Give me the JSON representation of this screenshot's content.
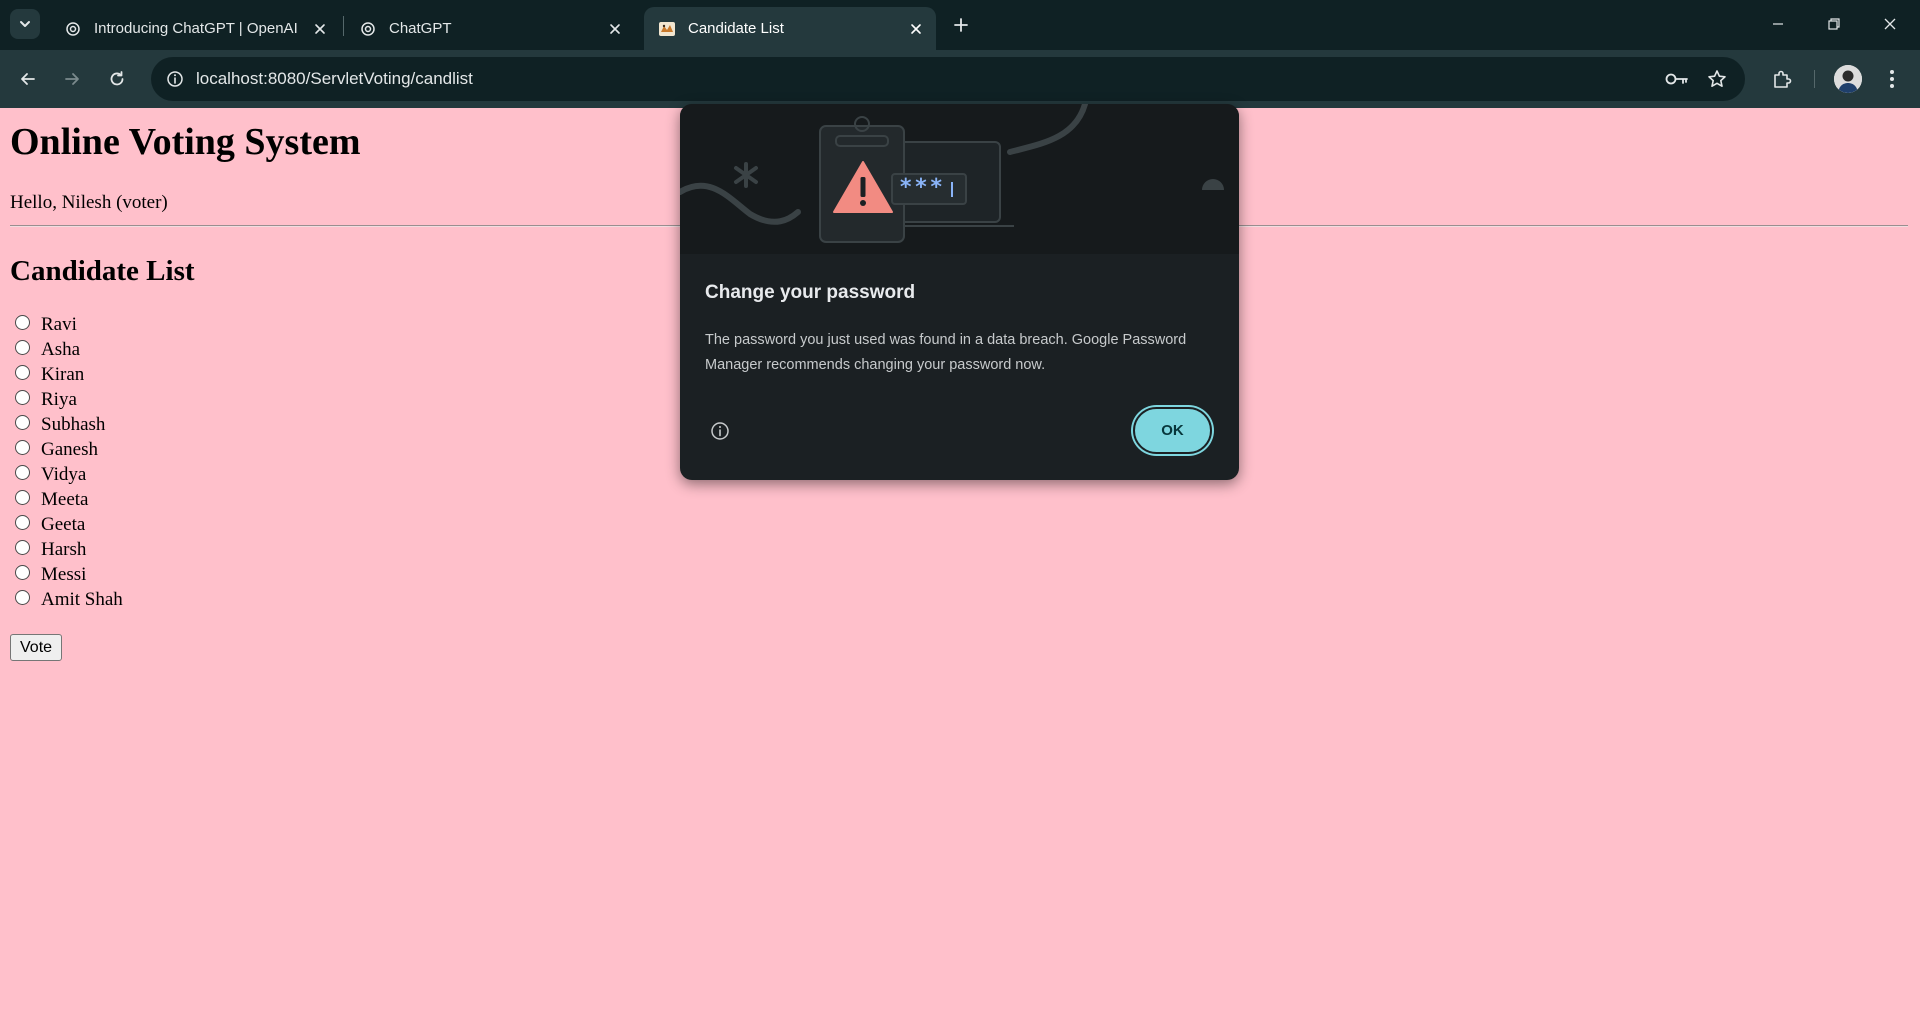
{
  "browser": {
    "tabs": [
      {
        "title": "Introducing ChatGPT | OpenAI",
        "favicon": "openai-icon",
        "active": false
      },
      {
        "title": "ChatGPT",
        "favicon": "openai-icon",
        "active": false
      },
      {
        "title": "Candidate List",
        "favicon": "tomcat-icon",
        "active": true
      }
    ],
    "address_bar": {
      "url": "localhost:8080/ServletVoting/candlist"
    },
    "colors": {
      "tabbar_bg": "#0f2124",
      "toolbar_bg": "#24393d",
      "omnibox_bg": "#0f2124"
    }
  },
  "page": {
    "title": "Online Voting System",
    "greeting": "Hello, Nilesh (voter)",
    "section_title": "Candidate List",
    "candidates": [
      {
        "name": "Ravi",
        "selected": false
      },
      {
        "name": "Asha",
        "selected": false
      },
      {
        "name": "Kiran",
        "selected": false
      },
      {
        "name": "Riya",
        "selected": false
      },
      {
        "name": "Subhash",
        "selected": false
      },
      {
        "name": "Ganesh",
        "selected": false
      },
      {
        "name": "Vidya",
        "selected": false
      },
      {
        "name": "Meeta",
        "selected": false
      },
      {
        "name": "Geeta",
        "selected": false
      },
      {
        "name": "Harsh",
        "selected": false
      },
      {
        "name": "Messi",
        "selected": false
      },
      {
        "name": "Amit Shah",
        "selected": false
      }
    ],
    "vote_button": "Vote",
    "background_color": "#ffc0cb"
  },
  "dialog": {
    "title": "Change your password",
    "body": "The password you just used was found in a data breach. Google Password Manager recommends changing your password now.",
    "ok_button": "OK",
    "illustration_text": "***",
    "accent_color": "#7ed6df",
    "warning_color": "#f28b82"
  }
}
